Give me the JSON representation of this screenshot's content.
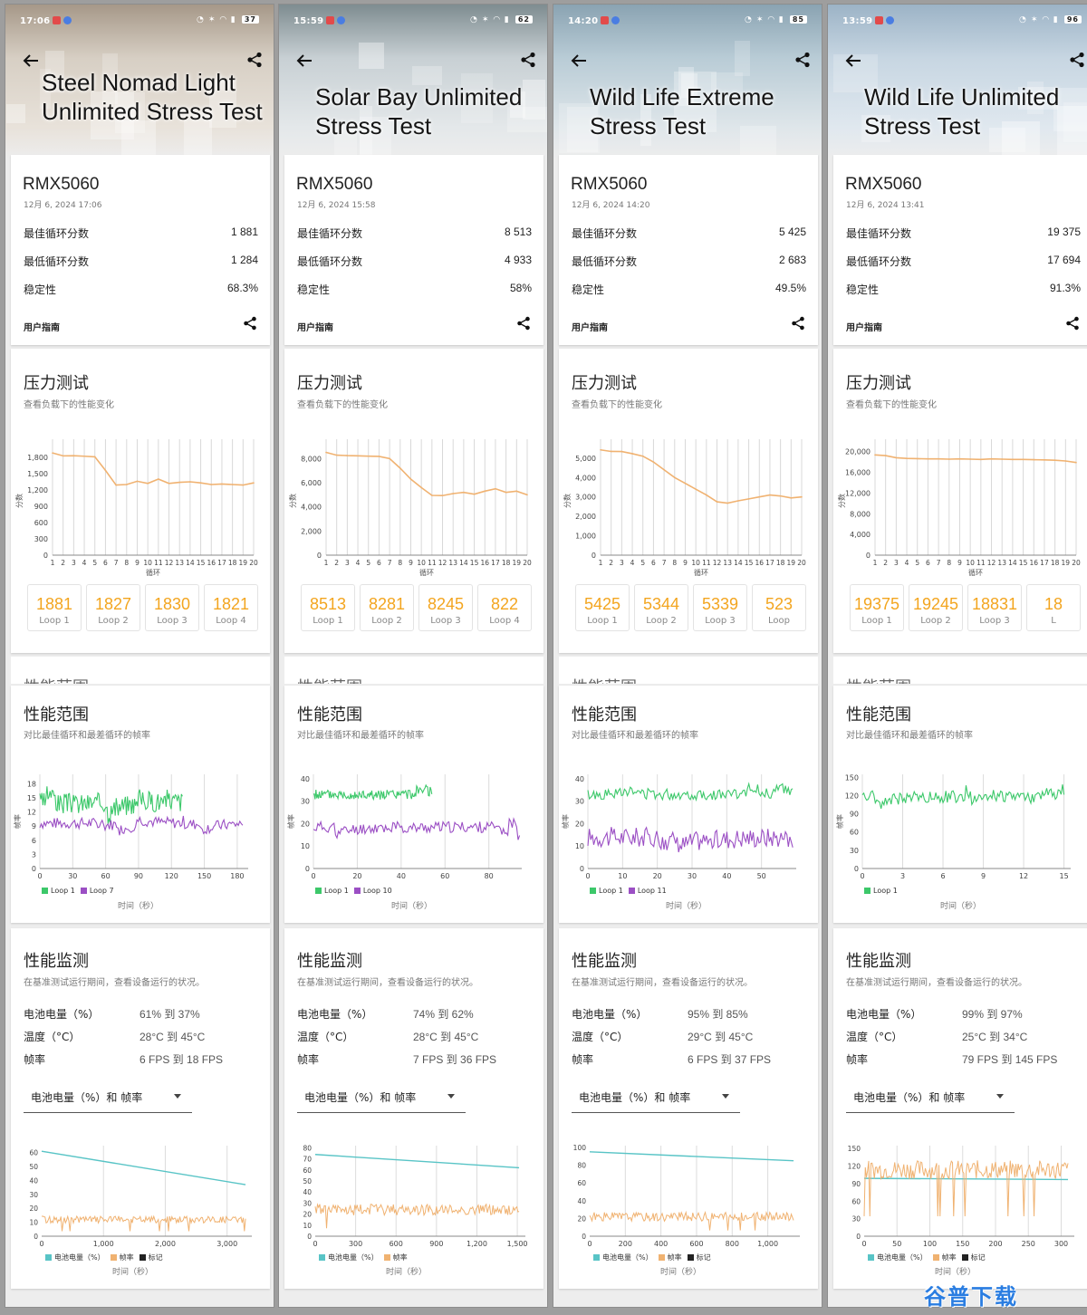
{
  "common": {
    "section_stress_title": "压力测试",
    "section_stress_sub": "查看负载下的性能变化",
    "section_range_title": "性能范围",
    "section_range_sub": "对比最佳循环和最差循环的帧率",
    "section_monitor_title": "性能监测",
    "section_monitor_sub": "在基准测试运行期间，查看设备运行的状况。",
    "label_best": "最佳循环分数",
    "label_worst": "最低循环分数",
    "label_stability": "稳定性",
    "label_guide": "用户指南",
    "label_battery": "电池电量（%）",
    "label_temp": "温度（°C）",
    "label_fps": "帧率",
    "dropdown_text": "电池电量（%）和 帧率",
    "stress_ylabel": "分数",
    "stress_xlabel": "循环",
    "range_ylabel": "帧率",
    "time_xlabel": "时间（秒）",
    "legend_battery": "电池电量（%）",
    "legend_fps": "帧率",
    "legend_mark": "标记",
    "colors": {
      "orange": "#f0b271",
      "green": "#3cc86a",
      "purple": "#9b4fc4",
      "teal": "#58c4c6",
      "loop_score": "#f3a51f"
    }
  },
  "phones": [
    {
      "status": {
        "time": "17:06",
        "battery": "37"
      },
      "title": "Steel Nomad Light Unlimited Stress Test",
      "device": "RMX5060",
      "date": "12月 6, 2024 17:06",
      "best": "1 881",
      "worst": "1 284",
      "stability": "68.3%",
      "loops": [
        {
          "score": "1881",
          "label": "Loop 1"
        },
        {
          "score": "1827",
          "label": "Loop 2"
        },
        {
          "score": "1830",
          "label": "Loop 3"
        },
        {
          "score": "1821",
          "label": "Loop 4"
        }
      ],
      "stress": {
        "yticks": [
          "1,800",
          "1,500",
          "1,200",
          "900",
          "600",
          "300",
          "0"
        ],
        "ymax": 2000,
        "yvals": [
          1800,
          1500,
          1200,
          900,
          600,
          300,
          0
        ],
        "values": [
          1881,
          1827,
          1830,
          1821,
          1810,
          1560,
          1290,
          1300,
          1360,
          1320,
          1400,
          1320,
          1340,
          1350,
          1330,
          1300,
          1310,
          1300,
          1290,
          1330
        ]
      },
      "range": {
        "ymax": 20,
        "yticks": [
          18,
          15,
          12,
          9,
          6,
          3,
          0
        ],
        "xticks": [
          0,
          30,
          60,
          90,
          120,
          150,
          180
        ],
        "xmax": 190,
        "series": [
          {
            "name": "Loop 1",
            "color": "green",
            "tmax": 130,
            "base": 14,
            "amp": 2.2,
            "seed": 3
          },
          {
            "name": "Loop 7",
            "color": "purple",
            "tmax": 185,
            "base": 9.6,
            "amp": 1.2,
            "seed": 7
          }
        ]
      },
      "monitor": {
        "battery": "61% 到 37%",
        "temp": "28°C 到 45°C",
        "fps": "6 FPS 到 18 FPS",
        "ymax": 65,
        "yticks": [
          60,
          50,
          40,
          30,
          20,
          10,
          0
        ],
        "xticks": [
          "1,000",
          "2,000",
          "3,000"
        ],
        "xtickvals": [
          1000,
          2000,
          3000
        ],
        "xmax": 3400,
        "battery_start": 61,
        "battery_end": 37,
        "fps_base": 12,
        "fps_amp": 2.5,
        "show_mark": true
      }
    },
    {
      "status": {
        "time": "15:59",
        "battery": "62"
      },
      "title": "Solar Bay Unlimited Stress Test",
      "device": "RMX5060",
      "date": "12月 6, 2024 15:58",
      "best": "8 513",
      "worst": "4 933",
      "stability": "58%",
      "loops": [
        {
          "score": "8513",
          "label": "Loop 1"
        },
        {
          "score": "8281",
          "label": "Loop 2"
        },
        {
          "score": "8245",
          "label": "Loop 3"
        },
        {
          "score": "822",
          "label": "Loop 4"
        }
      ],
      "stress": {
        "yticks": [
          "8,000",
          "6,000",
          "4,000",
          "2,000",
          "0"
        ],
        "ymax": 9000,
        "yvals": [
          8000,
          6000,
          4000,
          2000,
          0
        ],
        "values": [
          8513,
          8281,
          8245,
          8229,
          8200,
          8180,
          8000,
          7200,
          6300,
          5600,
          4950,
          4933,
          5100,
          5200,
          5050,
          5300,
          5500,
          5200,
          5300,
          5000
        ]
      },
      "range": {
        "ymax": 42,
        "yticks": [
          40,
          30,
          20,
          10,
          0
        ],
        "xticks": [
          0,
          20,
          40,
          60,
          80
        ],
        "xmax": 95,
        "series": [
          {
            "name": "Loop 1",
            "color": "green",
            "tmax": 54,
            "base": 33,
            "amp": 2.2,
            "seed": 5
          },
          {
            "name": "Loop 10",
            "color": "purple",
            "tmax": 94,
            "base": 18.5,
            "amp": 2.5,
            "seed": 11
          }
        ]
      },
      "monitor": {
        "battery": "74% 到 62%",
        "temp": "28°C 到 45°C",
        "fps": "7 FPS 到 36 FPS",
        "ymax": 82,
        "yticks": [
          80,
          70,
          60,
          50,
          40,
          30,
          20,
          10,
          0
        ],
        "xticks": [
          "300",
          "600",
          "900",
          "1,200",
          "1,500"
        ],
        "xtickvals": [
          300,
          600,
          900,
          1200,
          1500
        ],
        "xmax": 1560,
        "battery_start": 74,
        "battery_end": 62,
        "fps_base": 24,
        "fps_amp": 5,
        "show_mark": false
      }
    },
    {
      "status": {
        "time": "14:20",
        "battery": "85"
      },
      "title": "Wild Life Extreme Stress Test",
      "device": "RMX5060",
      "date": "12月 6, 2024 14:20",
      "best": "5 425",
      "worst": "2 683",
      "stability": "49.5%",
      "loops": [
        {
          "score": "5425",
          "label": "Loop 1"
        },
        {
          "score": "5344",
          "label": "Loop 2"
        },
        {
          "score": "5339",
          "label": "Loop 3"
        },
        {
          "score": "523",
          "label": "Loop"
        }
      ],
      "stress": {
        "yticks": [
          "5,000",
          "4,000",
          "3,000",
          "2,000",
          "1,000",
          "0"
        ],
        "ymax": 5600,
        "yvals": [
          5000,
          4000,
          3000,
          2000,
          1000,
          0
        ],
        "values": [
          5425,
          5344,
          5339,
          5230,
          5100,
          4800,
          4400,
          4000,
          3700,
          3400,
          3100,
          2750,
          2683,
          2800,
          2900,
          3000,
          3100,
          3050,
          2950,
          3000
        ]
      },
      "range": {
        "ymax": 42,
        "yticks": [
          40,
          30,
          20,
          10,
          0
        ],
        "xticks": [
          0,
          10,
          20,
          30,
          40,
          50
        ],
        "xmax": 60,
        "series": [
          {
            "name": "Loop 1",
            "color": "green",
            "tmax": 59,
            "base": 33,
            "amp": 2.5,
            "seed": 13
          },
          {
            "name": "Loop 11",
            "color": "purple",
            "tmax": 59,
            "base": 14,
            "amp": 4.5,
            "seed": 17
          }
        ]
      },
      "monitor": {
        "battery": "95% 到 85%",
        "temp": "29°C 到 45°C",
        "fps": "6 FPS 到 37 FPS",
        "ymax": 102,
        "yticks": [
          100,
          80,
          60,
          40,
          20,
          0
        ],
        "xticks": [
          "200",
          "400",
          "600",
          "800",
          "1,000"
        ],
        "xtickvals": [
          200,
          400,
          600,
          800,
          1000
        ],
        "xmax": 1180,
        "battery_start": 95,
        "battery_end": 85,
        "fps_base": 22,
        "fps_amp": 5,
        "show_mark": true
      }
    },
    {
      "status": {
        "time": "13:59",
        "battery": "96"
      },
      "title": "Wild Life Unlimited Stress Test",
      "device": "RMX5060",
      "date": "12月 6, 2024 13:41",
      "best": "19 375",
      "worst": "17 694",
      "stability": "91.3%",
      "loops": [
        {
          "score": "19375",
          "label": "Loop 1"
        },
        {
          "score": "19245",
          "label": "Loop 2"
        },
        {
          "score": "18831",
          "label": "Loop 3"
        },
        {
          "score": "18",
          "label": "L"
        }
      ],
      "stress": {
        "yticks": [
          "20,000",
          "16,000",
          "12,000",
          "8,000",
          "4,000",
          "0"
        ],
        "ymax": 21000,
        "yvals": [
          20000,
          16000,
          12000,
          8000,
          4000,
          0
        ],
        "values": [
          19375,
          19245,
          18831,
          18700,
          18650,
          18600,
          18600,
          18550,
          18600,
          18550,
          18500,
          18600,
          18550,
          18500,
          18500,
          18450,
          18400,
          18350,
          18200,
          17900
        ]
      },
      "range": {
        "ymax": 155,
        "yticks": [
          150,
          120,
          90,
          60,
          30,
          0
        ],
        "xticks": [
          0,
          3,
          6,
          9,
          12,
          15
        ],
        "xmax": 15.5,
        "series": [
          {
            "name": "Loop 1",
            "color": "green",
            "tmax": 15,
            "base": 118,
            "amp": 10,
            "seed": 19
          }
        ]
      },
      "monitor": {
        "battery": "99% 到 97%",
        "temp": "25°C 到 34°C",
        "fps": "79 FPS 到 145 FPS",
        "ymax": 155,
        "yticks": [
          150,
          120,
          90,
          60,
          30,
          0
        ],
        "xticks": [
          "50",
          "100",
          "150",
          "200",
          "250",
          "300"
        ],
        "xtickvals": [
          50,
          100,
          150,
          200,
          250,
          300
        ],
        "xmax": 320,
        "battery_start": 99,
        "battery_end": 97,
        "fps_base": 114,
        "fps_amp": 16,
        "show_mark": true
      }
    }
  ],
  "watermark": "谷普下载"
}
